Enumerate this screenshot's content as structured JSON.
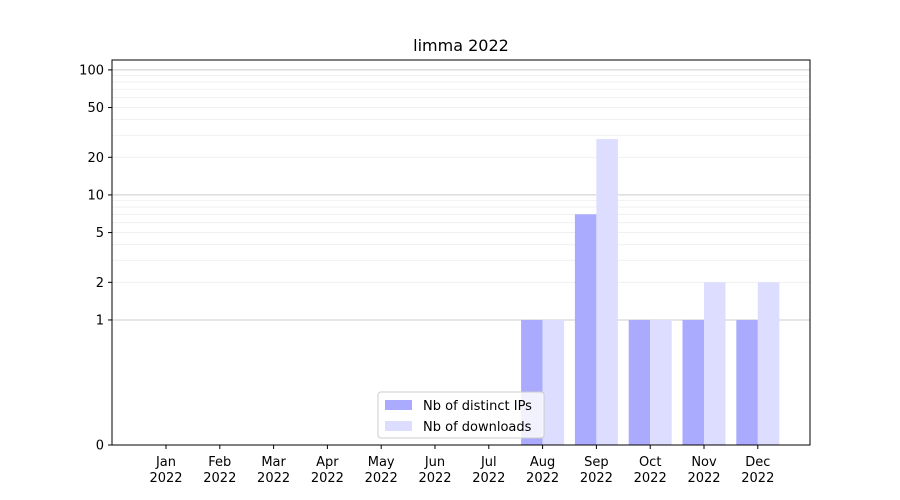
{
  "chart_data": {
    "type": "bar",
    "title": "limma 2022",
    "xlabel": "",
    "ylabel": "",
    "y_scale": "symlog",
    "ylim": [
      0,
      120
    ],
    "grid": "horizontal",
    "legend_position": "bottom-center",
    "categories": [
      {
        "month": "Jan",
        "year": "2022"
      },
      {
        "month": "Feb",
        "year": "2022"
      },
      {
        "month": "Mar",
        "year": "2022"
      },
      {
        "month": "Apr",
        "year": "2022"
      },
      {
        "month": "May",
        "year": "2022"
      },
      {
        "month": "Jun",
        "year": "2022"
      },
      {
        "month": "Jul",
        "year": "2022"
      },
      {
        "month": "Aug",
        "year": "2022"
      },
      {
        "month": "Sep",
        "year": "2022"
      },
      {
        "month": "Oct",
        "year": "2022"
      },
      {
        "month": "Nov",
        "year": "2022"
      },
      {
        "month": "Dec",
        "year": "2022"
      }
    ],
    "y_ticks": [
      {
        "value": 0,
        "label": "0"
      },
      {
        "value": 1,
        "label": "1"
      },
      {
        "value": 2,
        "label": "2"
      },
      {
        "value": 5,
        "label": "5"
      },
      {
        "value": 10,
        "label": "10"
      },
      {
        "value": 20,
        "label": "20"
      },
      {
        "value": 50,
        "label": "50"
      },
      {
        "value": 100,
        "label": "100"
      }
    ],
    "series": [
      {
        "name": "Nb of distinct IPs",
        "color": "#aaaaff",
        "values": [
          0,
          0,
          0,
          0,
          0,
          0,
          0,
          1,
          7,
          1,
          1,
          1
        ]
      },
      {
        "name": "Nb of downloads",
        "color": "#ddddff",
        "values": [
          0,
          0,
          0,
          0,
          0,
          0,
          0,
          1,
          28,
          1,
          2,
          2
        ]
      }
    ]
  }
}
